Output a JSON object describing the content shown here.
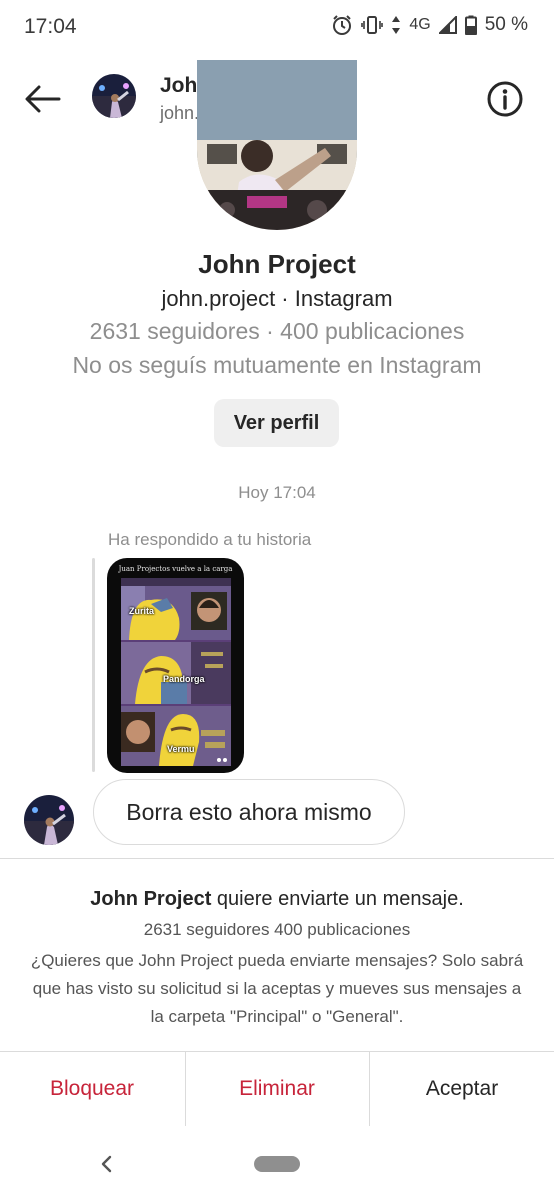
{
  "status_bar": {
    "time": "17:04",
    "network": "4G",
    "battery": "50 %",
    "icons": [
      "alarm-icon",
      "vibrate-icon",
      "data-arrows-icon",
      "signal-icon",
      "battery-icon"
    ]
  },
  "header": {
    "name": "John Project",
    "username": "john.project",
    "icons": [
      "back-arrow-icon",
      "info-icon"
    ]
  },
  "profile": {
    "name": "John Project",
    "handle_line": "john.project · Instagram",
    "stats": "2631 seguidores · 400 publicaciones",
    "mutual": "No os seguís mutuamente en Instagram",
    "view_profile_label": "Ver perfil"
  },
  "thread": {
    "timestamp": "Hoy 17:04",
    "story_reply_label": "Ha respondido a tu historia",
    "story": {
      "caption": "Juan Projectos vuelve a la carga",
      "labels": [
        "Zurita",
        "Pandorga",
        "Vermu"
      ]
    },
    "message": "Borra esto ahora mismo"
  },
  "request": {
    "title_name": "John Project",
    "title_rest": " quiere enviarte un mensaje.",
    "stats": "2631 seguidores 400 publicaciones",
    "body": "¿Quieres que John Project pueda enviarte mensajes? Solo sabrá que has visto su solicitud si la aceptas y mueves sus mensajes a la carpeta \"Principal\" o \"General\"."
  },
  "actions": {
    "block": "Bloquear",
    "delete": "Eliminar",
    "accept": "Aceptar"
  },
  "colors": {
    "destructive": "#c7243a",
    "muted_text": "#8e8e8e",
    "button_bg": "#efefef"
  }
}
